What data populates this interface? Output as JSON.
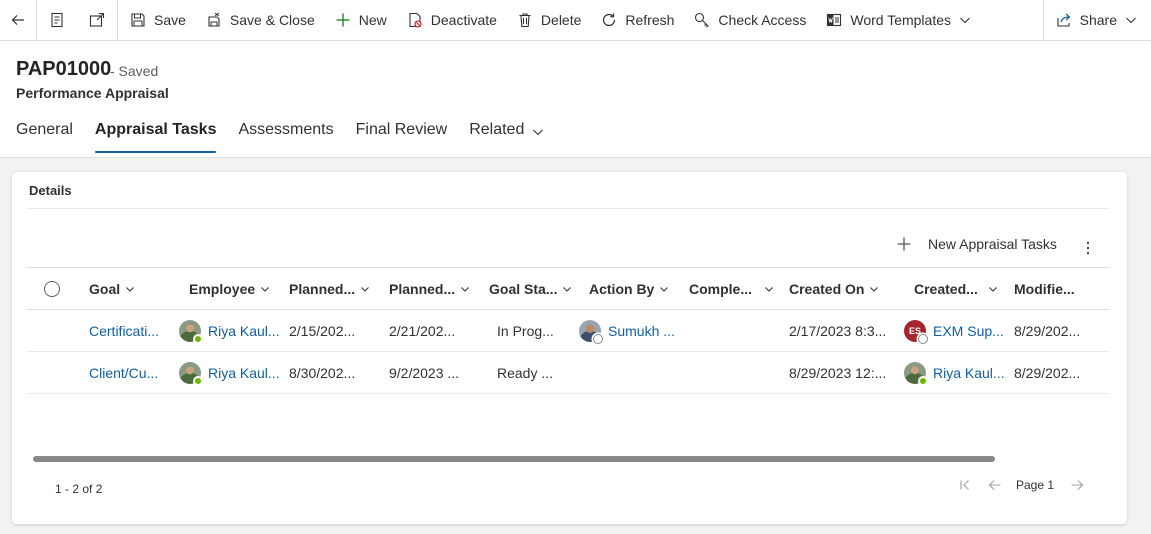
{
  "toolbar": {
    "save": "Save",
    "save_close": "Save & Close",
    "new": "New",
    "deactivate": "Deactivate",
    "delete": "Delete",
    "refresh": "Refresh",
    "check_access": "Check Access",
    "word_templates": "Word Templates",
    "share": "Share"
  },
  "record": {
    "title": "PAP01000",
    "status": "- Saved",
    "entity": "Performance Appraisal"
  },
  "tabs": [
    "General",
    "Appraisal Tasks",
    "Assessments",
    "Final Review",
    "Related"
  ],
  "section": {
    "title": "Details",
    "new_button": "New Appraisal Tasks"
  },
  "grid": {
    "columns": [
      "Goal",
      "Employee",
      "Planned...",
      "Planned...",
      "Goal Sta...",
      "Action By",
      "Comple...",
      "Created On",
      "Created...",
      "Modifie..."
    ],
    "rows": [
      {
        "goal": "Certificati...",
        "employee": "Riya Kaul...",
        "planned_start": "2/15/202...",
        "planned_end": "2/21/202...",
        "goal_status": "In Prog...",
        "action_by": "Sumukh ...",
        "completed": "",
        "created_on": "2/17/2023 8:3...",
        "created_by_initials": "ES",
        "created_by": "EXM Sup...",
        "modified": "8/29/202..."
      },
      {
        "goal": "Client/Cu...",
        "employee": "Riya Kaul...",
        "planned_start": "8/30/202...",
        "planned_end": "9/2/2023 ...",
        "goal_status": "Ready ...",
        "action_by": "",
        "completed": "",
        "created_on": "8/29/2023 12:...",
        "created_by": "Riya Kaul...",
        "modified": "8/29/202..."
      }
    ],
    "count_label": "1 - 2 of 2",
    "page_label": "Page 1"
  },
  "colors": {
    "accent": "#115ea3",
    "presence_online": "#6bb700",
    "avatar_es": "#a4262c"
  }
}
